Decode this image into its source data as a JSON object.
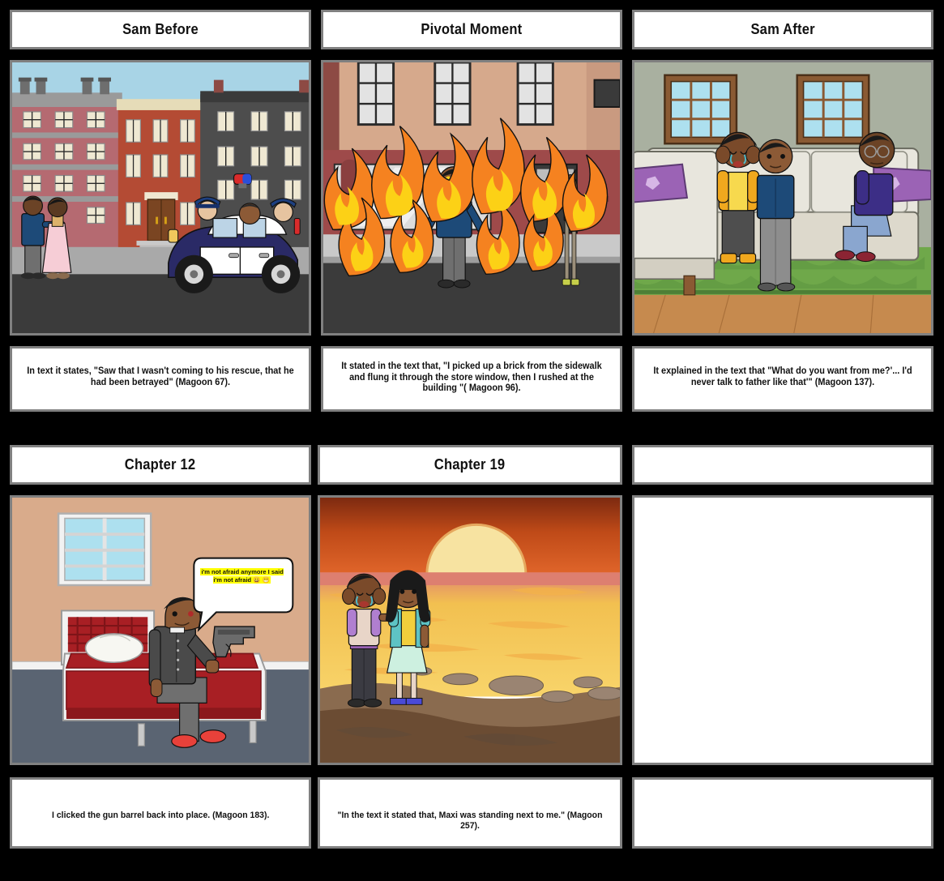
{
  "document": {
    "type": "storyboard",
    "background_color": "#000000",
    "panel_border_color": "#808080",
    "panel_fill_color": "#ffffff",
    "columns": 3,
    "rows": 2
  },
  "rows": [
    {
      "index": 1,
      "cells": [
        {
          "title": "Sam Before",
          "caption": "In text it states, \"Saw that I wasn't coming to his rescue, that he had been betrayed\" (Magoon 67).",
          "scene": "city-street-police-car",
          "scene_colors": {
            "sky": "#a8d4e6",
            "building_left": "#b56a71",
            "building_center": "#b44b34",
            "building_right": "#4d4d4d",
            "sidewalk": "#a9a9a9",
            "road": "#3b3b3b",
            "police_car_body": "#2a2a66",
            "police_car_panel": "#ffffff"
          }
        },
        {
          "title": "Pivotal Moment",
          "caption": "It stated in the text that, \"I picked up a brick from the sidewalk and flung it through the store window, then I rushed at the building \"( Magoon 96).",
          "scene": "burning-storefront",
          "scene_colors": {
            "building": "#d6a98c",
            "storefront": "#9e4a4a",
            "flame_outer": "#f58220",
            "flame_inner": "#fcd116",
            "sidewalk": "#c9c9c9",
            "road": "#3b3b3b",
            "shirt": "#1e3a5f"
          }
        },
        {
          "title": "Sam After",
          "caption": "It explained in the text that \"What do you want from me?'... I'd never talk to father like that'\" (Magoon 137).",
          "scene": "living-room-family",
          "scene_colors": {
            "wall": "#a9b0a0",
            "window_glass": "#ade0ef",
            "window_frame": "#8a5a33",
            "sofa": "#e8e6dd",
            "cushion": "#9b63b5",
            "rug": "#6fa84a",
            "floor": "#c68a4e"
          }
        }
      ]
    },
    {
      "index": 2,
      "cells": [
        {
          "title": "Chapter 12",
          "caption": "I clicked the gun barrel back into place. (Magoon 183).",
          "scene": "bedroom-gun",
          "speech_bubble": "i'm not afraid anymore I said i'm not afraid 😀 😁",
          "speech_bubble_highlight": "#ffff00",
          "scene_colors": {
            "wall": "#d9ab8b",
            "floor": "#5a6472",
            "bed_frame": "#f2f2f2",
            "mattress": "#a81f24",
            "headboard_plaid": "#a81f24",
            "window_glass": "#ade0ef",
            "jacket": "#4a4a4a",
            "shoes": "#e8413a"
          }
        },
        {
          "title": "Chapter 19",
          "caption": "\"In the text it stated that, Maxi was standing next to me.\" (Magoon 257).",
          "scene": "sunset-shore",
          "scene_colors": {
            "sky_top": "#8f2d12",
            "sky_mid": "#d9531e",
            "sun": "#f7e3a1",
            "water": "#f5c council",
            "sand": "#8a6b4f",
            "ground": "#6b4c33"
          }
        },
        {
          "title": "",
          "caption": "",
          "scene": "empty",
          "scene_colors": {}
        }
      ]
    }
  ]
}
